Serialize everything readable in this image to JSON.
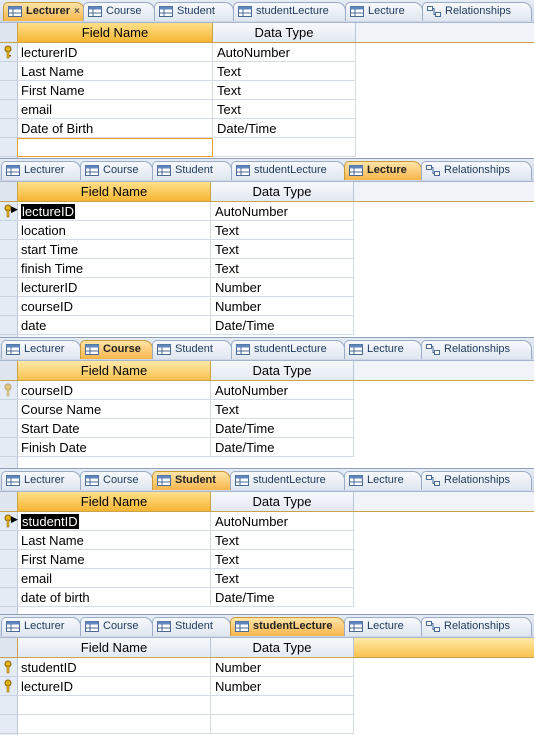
{
  "tab_labels": [
    "Lecturer",
    "Course",
    "Student",
    "studentLecture",
    "Lecture",
    "Relationships"
  ],
  "headers": {
    "field_name": "Field Name",
    "data_type": "Data Type"
  },
  "tables": {
    "lecturer": {
      "rows": [
        {
          "field": "lecturerID",
          "type": "AutoNumber",
          "key": true
        },
        {
          "field": "Last Name",
          "type": "Text"
        },
        {
          "field": "First Name",
          "type": "Text"
        },
        {
          "field": "email",
          "type": "Text"
        },
        {
          "field": "Date of Birth",
          "type": "Date/Time"
        }
      ]
    },
    "lecture": {
      "rows": [
        {
          "field": "lectureID",
          "type": "AutoNumber",
          "key": true
        },
        {
          "field": "location",
          "type": "Text"
        },
        {
          "field": "start Time",
          "type": "Text"
        },
        {
          "field": "finish Time",
          "type": "Text"
        },
        {
          "field": "lecturerID",
          "type": "Number"
        },
        {
          "field": "courseID",
          "type": "Number"
        },
        {
          "field": "date",
          "type": "Date/Time"
        }
      ]
    },
    "course": {
      "rows": [
        {
          "field": "courseID",
          "type": "AutoNumber"
        },
        {
          "field": "Course Name",
          "type": "Text"
        },
        {
          "field": "Start Date",
          "type": "Date/Time"
        },
        {
          "field": "Finish Date",
          "type": "Date/Time"
        }
      ]
    },
    "student": {
      "rows": [
        {
          "field": "studentID",
          "type": "AutoNumber"
        },
        {
          "field": "Last Name",
          "type": "Text"
        },
        {
          "field": "First Name",
          "type": "Text"
        },
        {
          "field": "email",
          "type": "Text"
        },
        {
          "field": "date of birth",
          "type": "Date/Time"
        }
      ]
    },
    "studentLecture": {
      "rows": [
        {
          "field": "studentID",
          "type": "Number",
          "key": true
        },
        {
          "field": "lectureID",
          "type": "Number",
          "key": true
        }
      ]
    }
  },
  "colors": {
    "active_tab": "#f7b54a",
    "header": "#f8c24e",
    "highlight": "#000000"
  }
}
